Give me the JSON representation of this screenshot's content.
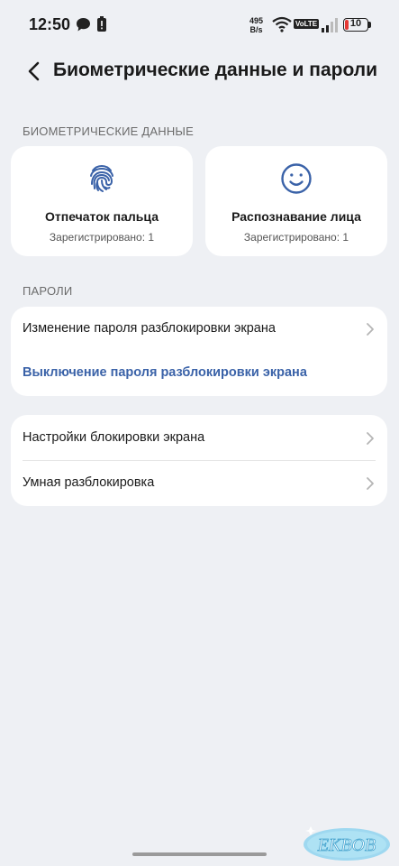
{
  "status": {
    "time": "12:50",
    "net_speed_value": "495",
    "net_speed_unit": "B/s",
    "volte": "VoLTE",
    "battery": "10",
    "battery_color": "#e53935"
  },
  "header": {
    "title": "Биометрические данные и пароли",
    "back_icon": "chevron-left-icon"
  },
  "biometrics": {
    "section_label": "БИОМЕТРИЧЕСКИЕ ДАННЫЕ",
    "cards": [
      {
        "icon": "fingerprint-icon",
        "title": "Отпечаток пальца",
        "subtitle": "Зарегистрировано: 1"
      },
      {
        "icon": "face-icon",
        "title": "Распознавание лица",
        "subtitle": "Зарегистрировано: 1"
      }
    ],
    "icon_color": "#3a62a8"
  },
  "passwords": {
    "section_label": "ПАРОЛИ",
    "change_label": "Изменение пароля разблокировки экрана",
    "disable_label": "Выключение пароля разблокировки экрана",
    "link_color": "#3a62a8"
  },
  "lock": {
    "settings_label": "Настройки блокировки экрана",
    "smart_label": "Умная разблокировка"
  },
  "watermark": {
    "text": "EKBOB"
  }
}
